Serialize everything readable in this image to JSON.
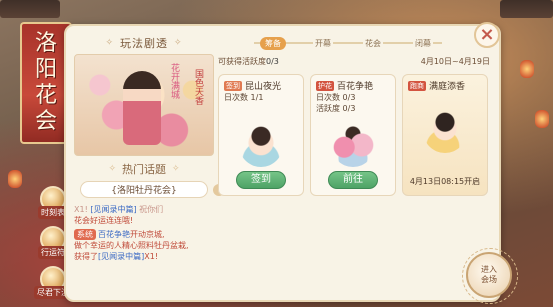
{
  "banner": {
    "title_chars": [
      "洛",
      "阳",
      "花",
      "会"
    ]
  },
  "side_buttons": [
    {
      "label": "时刻表",
      "icon": "clock-icon"
    },
    {
      "label": "行运符",
      "icon": "charm-icon"
    },
    {
      "label": "尽君下注",
      "icon": "bet-icon"
    }
  ],
  "left": {
    "play_title": "玩法剧透",
    "flourish": "✧",
    "artwork_stamps": [
      "国色天香",
      "花开满城"
    ],
    "hot_title": "热门话题",
    "topic": "{洛阳牡丹花会}",
    "chat": {
      "line1_a": "X1!",
      "line1_b": "[见闻录中篇]",
      "line1_c": "祝你们",
      "line1_d": "花会好运连连哦!",
      "sys_tag": "系统",
      "line2_a": "百花争艳",
      "line2_b": "开动京城,",
      "line2_c": "做个幸运的人",
      "line2_d": "精心照料牡丹盆栽,",
      "line2_e": "获得了",
      "line2_f": "[见闻录中篇]",
      "line2_g": "X1!"
    }
  },
  "right": {
    "tabs": [
      "筹备",
      "开幕",
      "花会",
      "闭幕"
    ],
    "active_tab": 0,
    "dates": "4月10日~4月19日",
    "activity_label": "可获得活跃度",
    "activity_value": "0/3",
    "cards": [
      {
        "tag": "签到",
        "name": "昆山夜光",
        "stats": [
          "日次数 1/1"
        ],
        "button": "签到"
      },
      {
        "tag": "护花",
        "name": "百花争艳",
        "stats": [
          "日次数 0/3",
          "活跃度 0/3"
        ],
        "button": "前往"
      },
      {
        "tag": "跑商",
        "name": "满庭添香",
        "stats": [],
        "time": "4月13日08:15开启"
      }
    ]
  },
  "close_label": "×",
  "enter_button": "进入\n会场"
}
